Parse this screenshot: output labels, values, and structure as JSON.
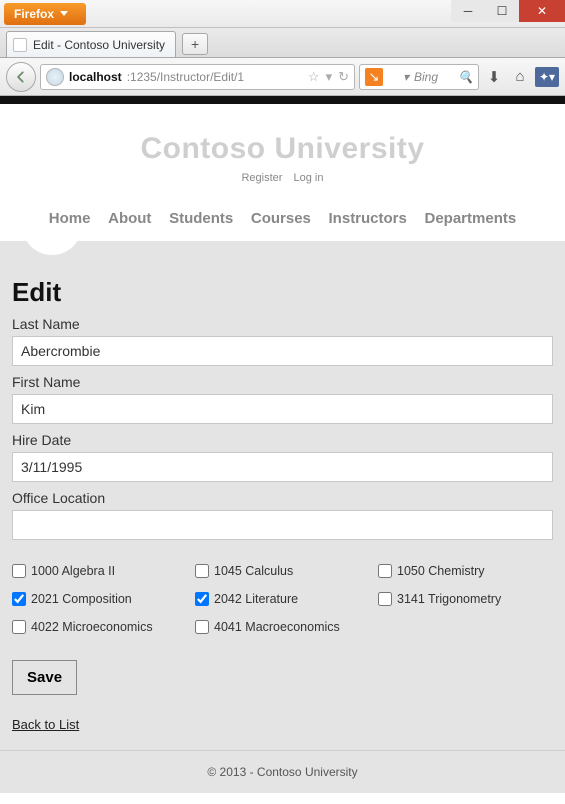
{
  "browser": {
    "app_name": "Firefox",
    "tab_title": "Edit - Contoso University",
    "url_host": "localhost",
    "url_path": ":1235/Instructor/Edit/1",
    "search_placeholder": "Bing"
  },
  "site": {
    "brand": "Contoso University",
    "account_links": {
      "register": "Register",
      "login": "Log in"
    },
    "nav": [
      "Home",
      "About",
      "Students",
      "Courses",
      "Instructors",
      "Departments"
    ]
  },
  "page": {
    "heading": "Edit",
    "fields": {
      "last_name": {
        "label": "Last Name",
        "value": "Abercrombie"
      },
      "first_name": {
        "label": "First Name",
        "value": "Kim"
      },
      "hire_date": {
        "label": "Hire Date",
        "value": "3/11/1995"
      },
      "office_location": {
        "label": "Office Location",
        "value": ""
      }
    },
    "courses": [
      {
        "label": "1000 Algebra II",
        "checked": false
      },
      {
        "label": "1045 Calculus",
        "checked": false
      },
      {
        "label": "1050 Chemistry",
        "checked": false
      },
      {
        "label": "2021 Composition",
        "checked": true
      },
      {
        "label": "2042 Literature",
        "checked": true
      },
      {
        "label": "3141 Trigonometry",
        "checked": false
      },
      {
        "label": "4022 Microeconomics",
        "checked": false
      },
      {
        "label": "4041 Macroeconomics",
        "checked": false
      }
    ],
    "save_label": "Save",
    "back_link": "Back to List"
  },
  "footer": "© 2013 - Contoso University"
}
